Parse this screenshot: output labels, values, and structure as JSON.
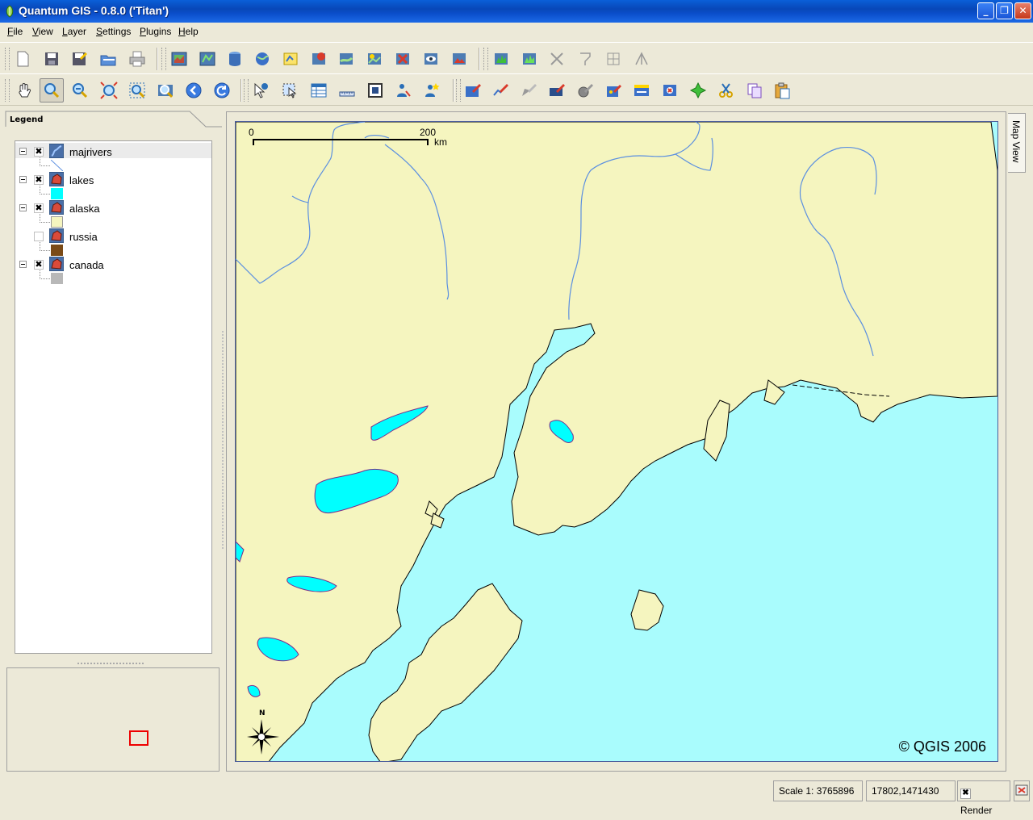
{
  "window": {
    "title": "Quantum GIS - 0.8.0 ('Titan')",
    "controls": [
      "minimize-icon",
      "restore-icon",
      "close-icon"
    ]
  },
  "menu": {
    "items": [
      "File",
      "View",
      "Layer",
      "Settings",
      "Plugins",
      "Help"
    ]
  },
  "toolbar1": {
    "buttons": [
      "new-project-icon",
      "save-icon",
      "save-as-icon",
      "open-project-icon",
      "print-icon",
      "add-raster-icon",
      "add-vector-icon",
      "add-postgis-icon",
      "add-wms-icon",
      "new-vector-icon",
      "remove-layer-icon",
      "layer-properties-icon",
      "show-all-icon",
      "hide-all-icon",
      "overview-icon",
      "grass-mapset-icon",
      "grass-tools-icon",
      "tools-disabled-icon",
      "georef-icon",
      "georef-mask-icon",
      "digitize-icon"
    ]
  },
  "toolbar2": {
    "buttons": [
      "pan-icon",
      "zoom-in-icon",
      "zoom-out-icon",
      "zoom-full-icon",
      "zoom-layer-icon",
      "zoom-selected-icon",
      "zoom-last-icon",
      "refresh-icon",
      "identify-icon",
      "select-icon",
      "attribute-table-icon",
      "measure-line-icon",
      "measure-area-icon",
      "map-tips-icon",
      "show-bookmarks-icon",
      "capture-point-icon",
      "capture-line-icon",
      "capture-polygon-icon",
      "delete-vertex-icon",
      "add-vertex-icon",
      "move-vertex-icon",
      "add-island-icon",
      "delete-feature-icon",
      "add-ring-icon",
      "cut-features-icon",
      "copy-features-icon",
      "paste-features-icon"
    ]
  },
  "legend": {
    "title": "Legend",
    "layers": [
      {
        "name": "majrivers",
        "checked": true,
        "type": "line",
        "symbol_color": "#5b8fe0"
      },
      {
        "name": "lakes",
        "checked": true,
        "type": "polygon",
        "symbol_color": "#00ffff"
      },
      {
        "name": "alaska",
        "checked": true,
        "type": "polygon",
        "symbol_color": "#f5f5bf"
      },
      {
        "name": "russia",
        "checked": false,
        "type": "polygon",
        "symbol_color": "#7a4a16"
      },
      {
        "name": "canada",
        "checked": true,
        "type": "polygon",
        "symbol_color": "#b8b8b8"
      }
    ]
  },
  "map": {
    "sea_color": "#a9fcfd",
    "land_color": "#f5f5bf",
    "river_color": "#5b8fe0",
    "lake_color": "#00ffff",
    "scalebar": {
      "start": "0",
      "end": "200",
      "unit": "km"
    },
    "north_label": "N",
    "copyright": "© QGIS 2006"
  },
  "mapview_tab": {
    "label": "Map View"
  },
  "status": {
    "scale": "Scale 1: 3765896",
    "coords": "17802,1471430",
    "render_label": "Render",
    "render_checked": true
  }
}
